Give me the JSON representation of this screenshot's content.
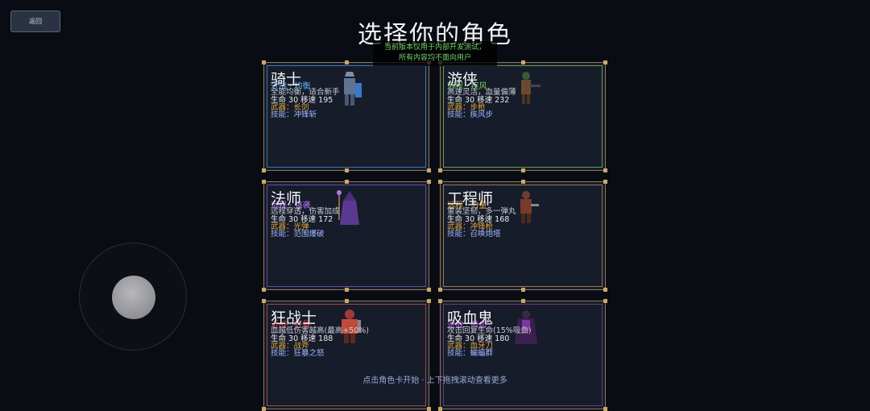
{
  "back_label": "返回",
  "title": "选择你的角色",
  "notice": [
    "当前版本仅用于内部开发测试，",
    "所有内容均不面向用户"
  ],
  "hint": "点击角色卡开始 · 上下拖拽滚动查看更多",
  "cards": [
    {
      "name": "骑士",
      "cls": "近战 · 均衡",
      "desc": "全能均衡，适合新手",
      "stats": "生命 30   移速 195",
      "weapon": "武器：长剑",
      "skill": "技能：冲锋斩",
      "accent": "#3b78a8",
      "clsc": "#59b6f2",
      "sprite": "knight-sprite-icon"
    },
    {
      "name": "游侠",
      "cls": "远程 · 疾风",
      "desc": "高速灵活，血量偏薄",
      "stats": "生命 30   移速 232",
      "weapon": "武器：步枪",
      "skill": "技能：疾风步",
      "accent": "#6e9a48",
      "clsc": "#74d06a",
      "sprite": "ranger-sprite-icon"
    },
    {
      "name": "法师",
      "cls": "远程 · 强袭",
      "desc": "远程穿透，伤害加成",
      "stats": "生命 30   移速 172",
      "weapon": "武器：光弹",
      "skill": "技能：范围爆破",
      "accent": "#6a4a9a",
      "clsc": "#b07af0",
      "sprite": "mage-sprite-icon"
    },
    {
      "name": "工程师",
      "cls": "远程 · 力量",
      "desc": "重装坚韧，多一弹丸",
      "stats": "生命 30   移速 168",
      "weapon": "武器：冲锋枪",
      "skill": "技能：召唤炮塔",
      "accent": "#9a7a4a",
      "clsc": "#e0a93a",
      "sprite": "engineer-sprite-icon"
    },
    {
      "name": "狂战士",
      "cls": "近战 · 狂暴",
      "desc": "血越低伤害越高(最高+50%)",
      "stats": "生命 30   移速 188",
      "weapon": "武器：战斧",
      "skill": "技能：狂暴之怒",
      "accent": "#9a4a4a",
      "clsc": "#e04848",
      "sprite": "berserker-sprite-icon"
    },
    {
      "name": "吸血鬼",
      "cls": "近战 · 吸血",
      "desc": "攻击回复生命(15%吸血)",
      "stats": "生命 30   移速 180",
      "weapon": "武器：血牙刀",
      "skill": "技能：蝙蝠群",
      "accent": "#6a3a7a",
      "clsc": "#c060e0",
      "sprite": "vampire-sprite-icon"
    }
  ]
}
